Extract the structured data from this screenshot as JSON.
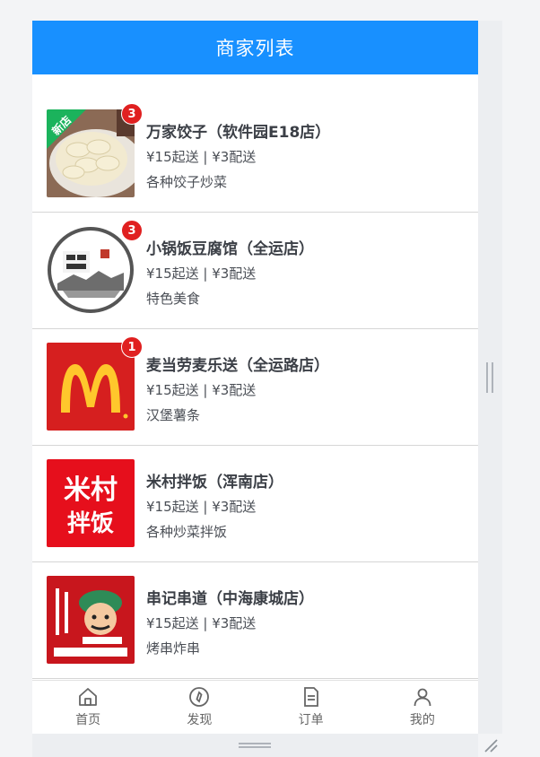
{
  "header": {
    "title": "商家列表"
  },
  "merchants": [
    {
      "name": "万家饺子（软件园E18店）",
      "price": "¥15起送 | ¥3配送",
      "desc": "各种饺子炒菜",
      "badge": "3",
      "thumb_tag": "新店"
    },
    {
      "name": "小锅饭豆腐馆（全运店）",
      "price": "¥15起送 | ¥3配送",
      "desc": "特色美食",
      "badge": "3"
    },
    {
      "name": "麦当劳麦乐送（全运路店）",
      "price": "¥15起送 | ¥3配送",
      "desc": "汉堡薯条",
      "badge": "1"
    },
    {
      "name": "米村拌饭（浑南店）",
      "price": "¥15起送 | ¥3配送",
      "desc": "各种炒菜拌饭",
      "logo_top": "米村",
      "logo_bottom": "拌饭"
    },
    {
      "name": "串记串道（中海康城店）",
      "price": "¥15起送 | ¥3配送",
      "desc": "烤串炸串"
    }
  ],
  "tabbar": [
    {
      "label": "首页",
      "icon": "home-icon"
    },
    {
      "label": "发现",
      "icon": "compass-icon"
    },
    {
      "label": "订单",
      "icon": "order-icon"
    },
    {
      "label": "我的",
      "icon": "user-icon"
    }
  ],
  "colors": {
    "primary": "#1890ff",
    "badge": "#e02020"
  }
}
